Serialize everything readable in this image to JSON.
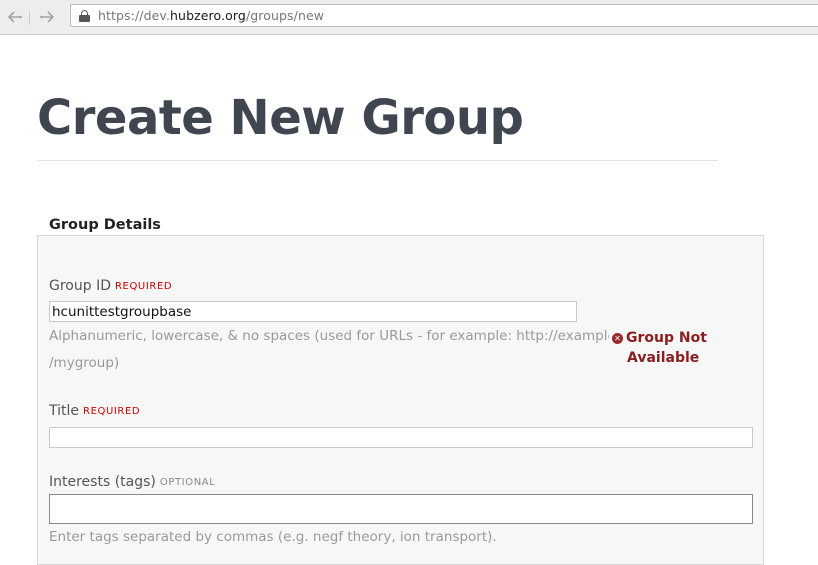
{
  "browser": {
    "back_icon": "back-arrow-icon",
    "forward_icon": "forward-arrow-icon",
    "lock_icon": "lock-icon",
    "url_scheme": "https://dev.",
    "url_host": "hubzero.org",
    "url_path": "/groups/new"
  },
  "page": {
    "title": "Create New Group"
  },
  "form": {
    "legend": "Group Details",
    "group_id": {
      "label": "Group ID",
      "badge": "REQUIRED",
      "value": "hcunittestgroupbase",
      "hint_line1": "Alphanumeric, lowercase, & no spaces (used for URLs - for example: http://example.com/groups",
      "hint_line2": "/mygroup)",
      "error_icon": "error-x-icon",
      "error_line1": "Group Not",
      "error_line2": "Available"
    },
    "title_field": {
      "label": "Title",
      "badge": "REQUIRED",
      "value": ""
    },
    "interests": {
      "label": "Interests (tags)",
      "badge": "OPTIONAL",
      "value": "",
      "hint": "Enter tags separated by commas (e.g. negf theory, ion transport)."
    }
  }
}
